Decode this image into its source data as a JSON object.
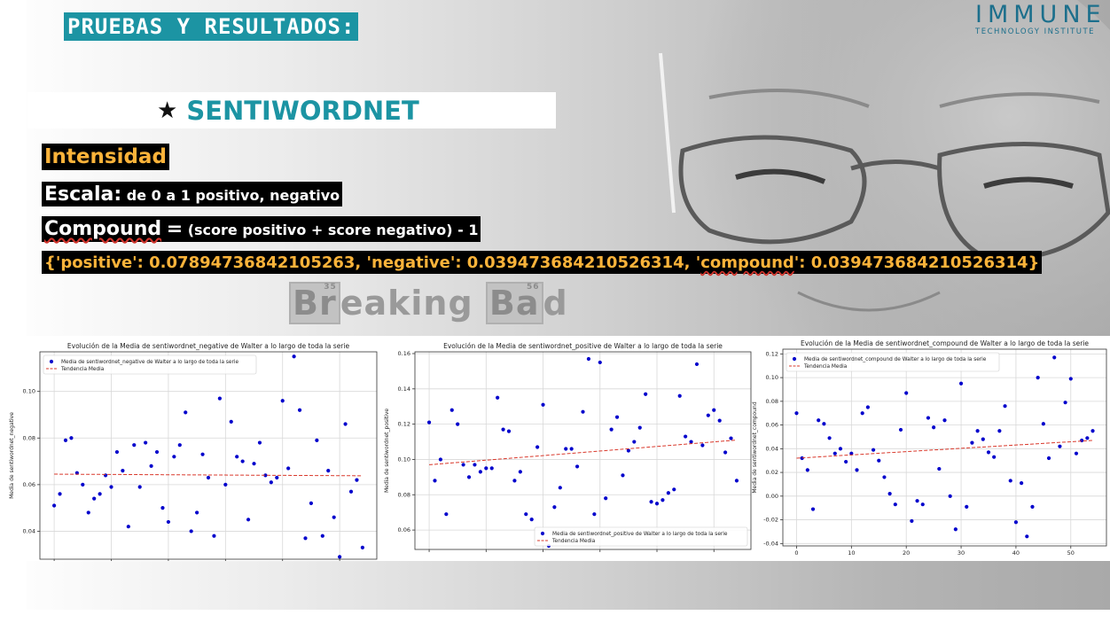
{
  "slide": {
    "title": "PRUEBAS Y RESULTADOS:",
    "logo_main": "IMMUNE",
    "logo_sub": "TECHNOLOGY INSTITUTE",
    "section_star": "★",
    "section_title": "SENTIWORDNET",
    "intensity_label": "Intensidad",
    "scale_label": "Escala:",
    "scale_text": "de 0 a 1 positivo, negativo",
    "compound_label": "Compound",
    "compound_eq": "=",
    "compound_formula": "(score positivo + score negativo) - 1",
    "result_part1": "{'positive': 0.07894736842105263, 'negative': 0.039473684210526314, '",
    "result_key": "compound",
    "result_part2": "': 0.039473684210526314}",
    "bb_part1": "Br",
    "bb_el1": "eaking",
    "bb_num1": "35",
    "bb_part2": "",
    "bb_el2": "Ba",
    "bb_num2": "56",
    "bb_part3": "d"
  },
  "chart_data": [
    {
      "type": "scatter",
      "title": "Evolución de la Media de sentiwordnet_negative de Walter a lo largo de toda la serie",
      "xlabel": "",
      "ylabel": "Media de sentiwordnet_negative",
      "ylim": [
        0.028,
        0.117
      ],
      "yticks": [
        0.04,
        0.06,
        0.08,
        0.1
      ],
      "xlim": [
        -2.5,
        56.5
      ],
      "grid": true,
      "legend_position": "top-left",
      "series": [
        {
          "name": "Media de sentiwordnet_negative de Walter a lo largo de toda la serie",
          "color": "#0000cc",
          "values": [
            0.051,
            0.056,
            0.079,
            0.08,
            0.065,
            0.06,
            0.048,
            0.054,
            0.056,
            0.064,
            0.059,
            0.074,
            0.066,
            0.042,
            0.077,
            0.059,
            0.078,
            0.068,
            0.074,
            0.05,
            0.044,
            0.072,
            0.077,
            0.091,
            0.04,
            0.048,
            0.073,
            0.063,
            0.038,
            0.097,
            0.06,
            0.087,
            0.072,
            0.07,
            0.045,
            0.069,
            0.078,
            0.064,
            0.061,
            0.063,
            0.096,
            0.067,
            0.115,
            0.092,
            0.037,
            0.052,
            0.079,
            0.038,
            0.066,
            0.046,
            0.029,
            0.086,
            0.057,
            0.062,
            0.033
          ]
        },
        {
          "name": "Tendencia Media",
          "color": "#d9382b",
          "style": "dashed",
          "x": [
            0,
            54
          ],
          "values": [
            0.0645,
            0.0638
          ]
        }
      ]
    },
    {
      "type": "scatter",
      "title": "Evolución de la Media de sentiwordnet_positive de Walter a lo largo de toda la serie",
      "xlabel": "",
      "ylabel": "Media de sentiwordnet_positive",
      "ylim": [
        0.049,
        0.161
      ],
      "yticks": [
        0.06,
        0.08,
        0.1,
        0.12,
        0.14,
        0.16
      ],
      "xlim": [
        -2.5,
        56.5
      ],
      "grid": true,
      "legend_position": "bottom-right",
      "series": [
        {
          "name": "Media de sentiwordnet_positive de Walter a lo largo de toda la serie",
          "color": "#0000cc",
          "values": [
            0.121,
            0.088,
            0.1,
            0.069,
            0.128,
            0.12,
            0.097,
            0.09,
            0.097,
            0.093,
            0.095,
            0.095,
            0.135,
            0.117,
            0.116,
            0.088,
            0.093,
            0.069,
            0.066,
            0.107,
            0.131,
            0.051,
            0.073,
            0.084,
            0.106,
            0.106,
            0.096,
            0.127,
            0.157,
            0.069,
            0.155,
            0.078,
            0.117,
            0.124,
            0.091,
            0.105,
            0.11,
            0.118,
            0.137,
            0.076,
            0.075,
            0.077,
            0.081,
            0.083,
            0.136,
            0.113,
            0.11,
            0.154,
            0.108,
            0.125,
            0.128,
            0.122,
            0.104,
            0.112,
            0.088
          ]
        },
        {
          "name": "Tendencia Media",
          "color": "#d9382b",
          "style": "dashed",
          "x": [
            0,
            54
          ],
          "values": [
            0.097,
            0.111
          ]
        }
      ]
    },
    {
      "type": "scatter",
      "title": "Evolución de la Media de sentiwordnet_compound de Walter a lo largo de toda la serie",
      "xlabel": "",
      "ylabel": "Media de sentiwordnet_compound",
      "ylim": [
        -0.042,
        0.124
      ],
      "yticks": [
        -0.04,
        -0.02,
        0.0,
        0.02,
        0.04,
        0.06,
        0.08,
        0.1,
        0.12
      ],
      "xlim": [
        -2.5,
        56.5
      ],
      "xticks": [
        0,
        10,
        20,
        30,
        40,
        50
      ],
      "grid": true,
      "legend_position": "top-left",
      "series": [
        {
          "name": "Media de sentiwordnet_compound de Walter a lo largo de toda la serie",
          "color": "#0000cc",
          "values": [
            0.07,
            0.032,
            0.022,
            -0.011,
            0.064,
            0.061,
            0.049,
            0.036,
            0.04,
            0.029,
            0.036,
            0.022,
            0.07,
            0.075,
            0.039,
            0.03,
            0.016,
            0.002,
            -0.007,
            0.056,
            0.087,
            -0.021,
            -0.004,
            -0.007,
            0.066,
            0.058,
            0.023,
            0.064,
            0.0,
            -0.028,
            0.095,
            -0.009,
            0.045,
            0.055,
            0.048,
            0.037,
            0.033,
            0.055,
            0.076,
            0.013,
            -0.022,
            0.011,
            -0.034,
            -0.009,
            0.1,
            0.061,
            0.032,
            0.117,
            0.042,
            0.079,
            0.099,
            0.036,
            0.047,
            0.049,
            0.055
          ]
        },
        {
          "name": "Tendencia Media",
          "color": "#d9382b",
          "style": "dashed",
          "x": [
            0,
            54
          ],
          "values": [
            0.032,
            0.047
          ]
        }
      ]
    }
  ]
}
